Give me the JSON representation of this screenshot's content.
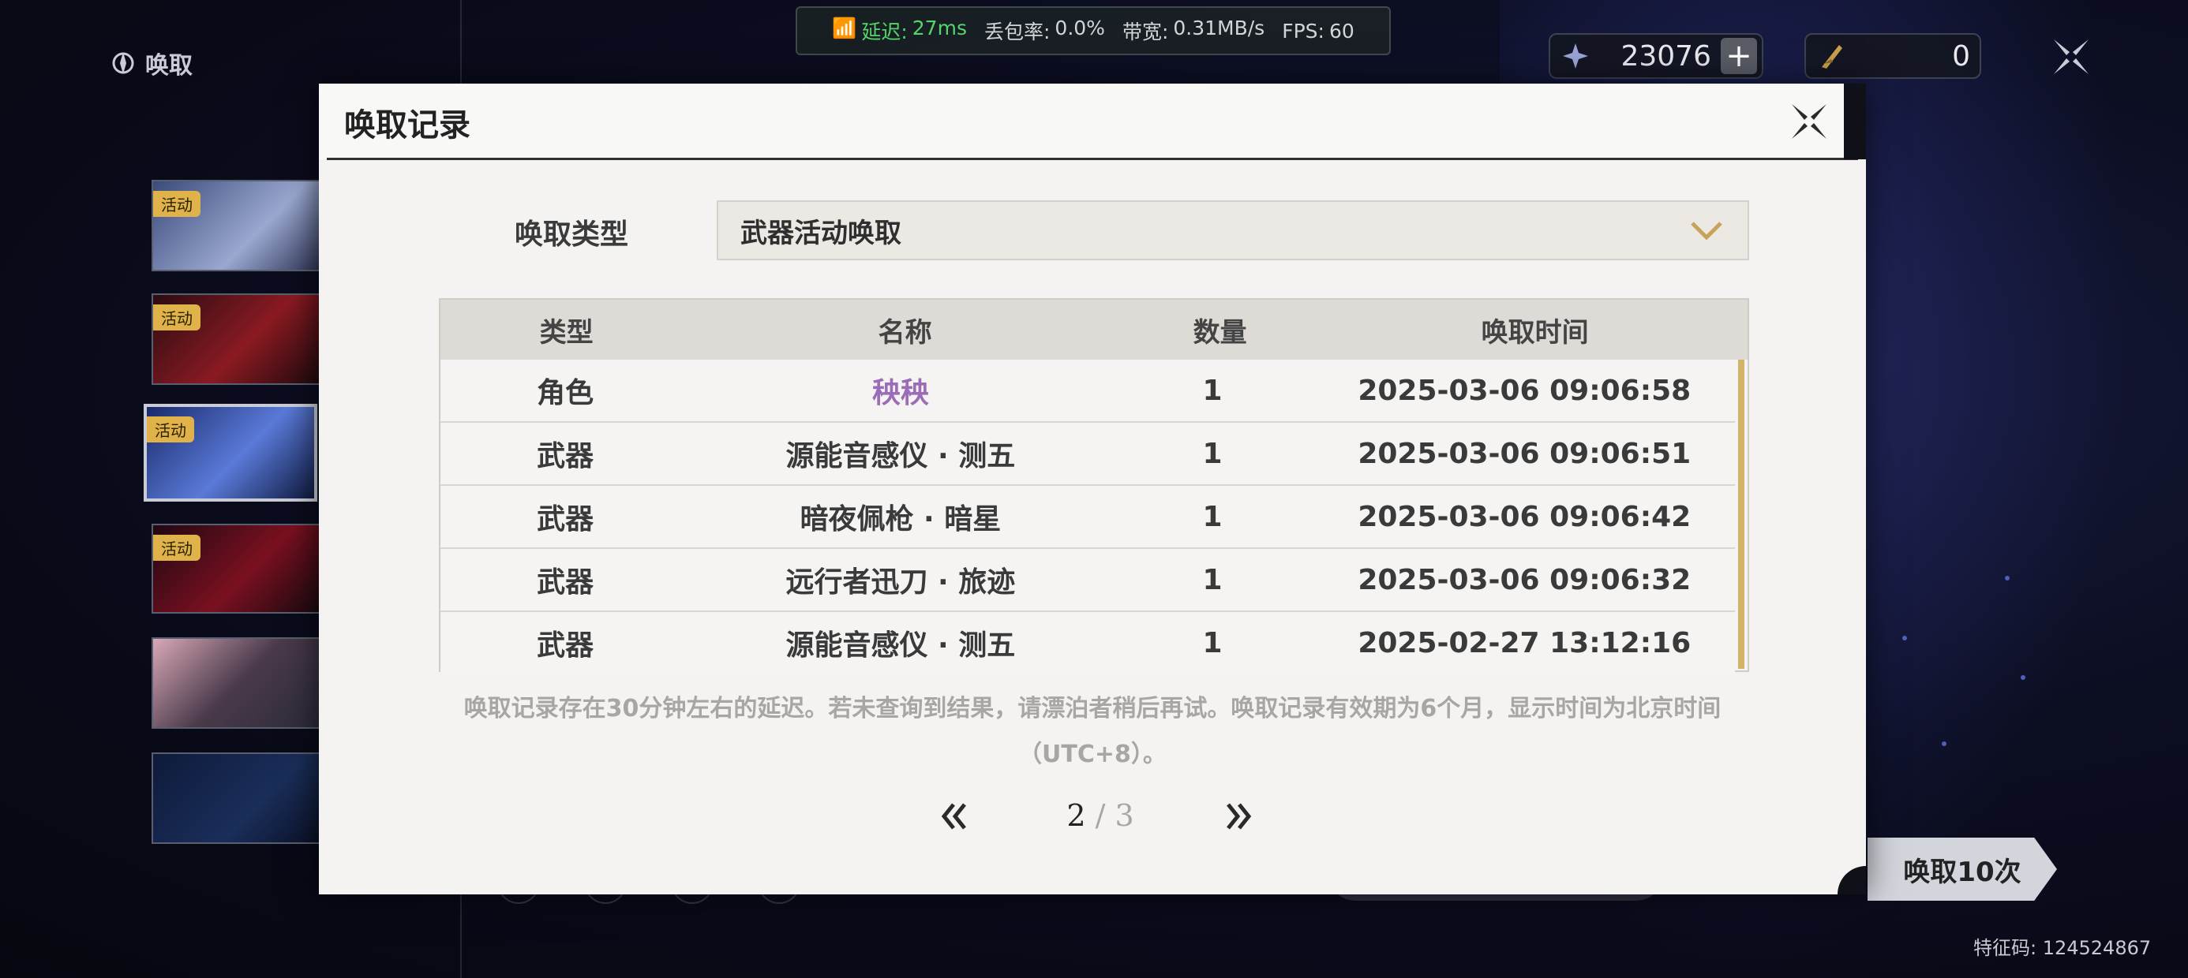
{
  "top_bar": {
    "title": "唤取",
    "net": {
      "latency_label": "延迟:",
      "latency_value": "27ms",
      "loss_label": "丢包率:",
      "loss_value": "0.0%",
      "bandwidth_label": "带宽:",
      "bandwidth_value": "0.31MB/s",
      "fps_label": "FPS:",
      "fps_value": "60"
    },
    "currency_1": {
      "icon": "astrite-icon",
      "value": "23076",
      "plus": "+"
    },
    "currency_2": {
      "icon": "lustrous-tide-icon",
      "value": "0"
    },
    "close_icon": "close-icon"
  },
  "banners": [
    {
      "badge": "活动"
    },
    {
      "badge": "活动"
    },
    {
      "badge": "活动"
    },
    {
      "badge": "活动"
    },
    {
      "badge": ""
    },
    {
      "badge": ""
    }
  ],
  "bottom": {
    "pull_ten_label": "唤取10次",
    "feature_code": "特征码: 124524867"
  },
  "modal": {
    "title": "唤取记录",
    "type_label": "唤取类型",
    "type_value": "武器活动唤取",
    "columns": [
      "类型",
      "名称",
      "数量",
      "唤取时间"
    ],
    "rows": [
      {
        "type": "角色",
        "name": "秧秧",
        "count": "1",
        "time": "2025-03-06 09:06:58",
        "highlight": true
      },
      {
        "type": "武器",
        "name": "源能音感仪 · 测五",
        "count": "1",
        "time": "2025-03-06 09:06:51"
      },
      {
        "type": "武器",
        "name": "暗夜佩枪 · 暗星",
        "count": "1",
        "time": "2025-03-06 09:06:42"
      },
      {
        "type": "武器",
        "name": "远行者迅刀 · 旅迹",
        "count": "1",
        "time": "2025-03-06 09:06:32"
      },
      {
        "type": "武器",
        "name": "源能音感仪 · 测五",
        "count": "1",
        "time": "2025-02-27 13:12:16"
      }
    ],
    "note": "唤取记录存在30分钟左右的延迟。若未查询到结果，请漂泊者稍后再试。唤取记录有效期为6个月，显示时间为北京时间（UTC+8）。",
    "pager": {
      "current": "2",
      "separator": "/",
      "total": "3"
    }
  },
  "colors": {
    "accent_gold": "#d1b46a",
    "highlight_purple": "#9b6cb8",
    "latency_green": "#55d46a"
  }
}
